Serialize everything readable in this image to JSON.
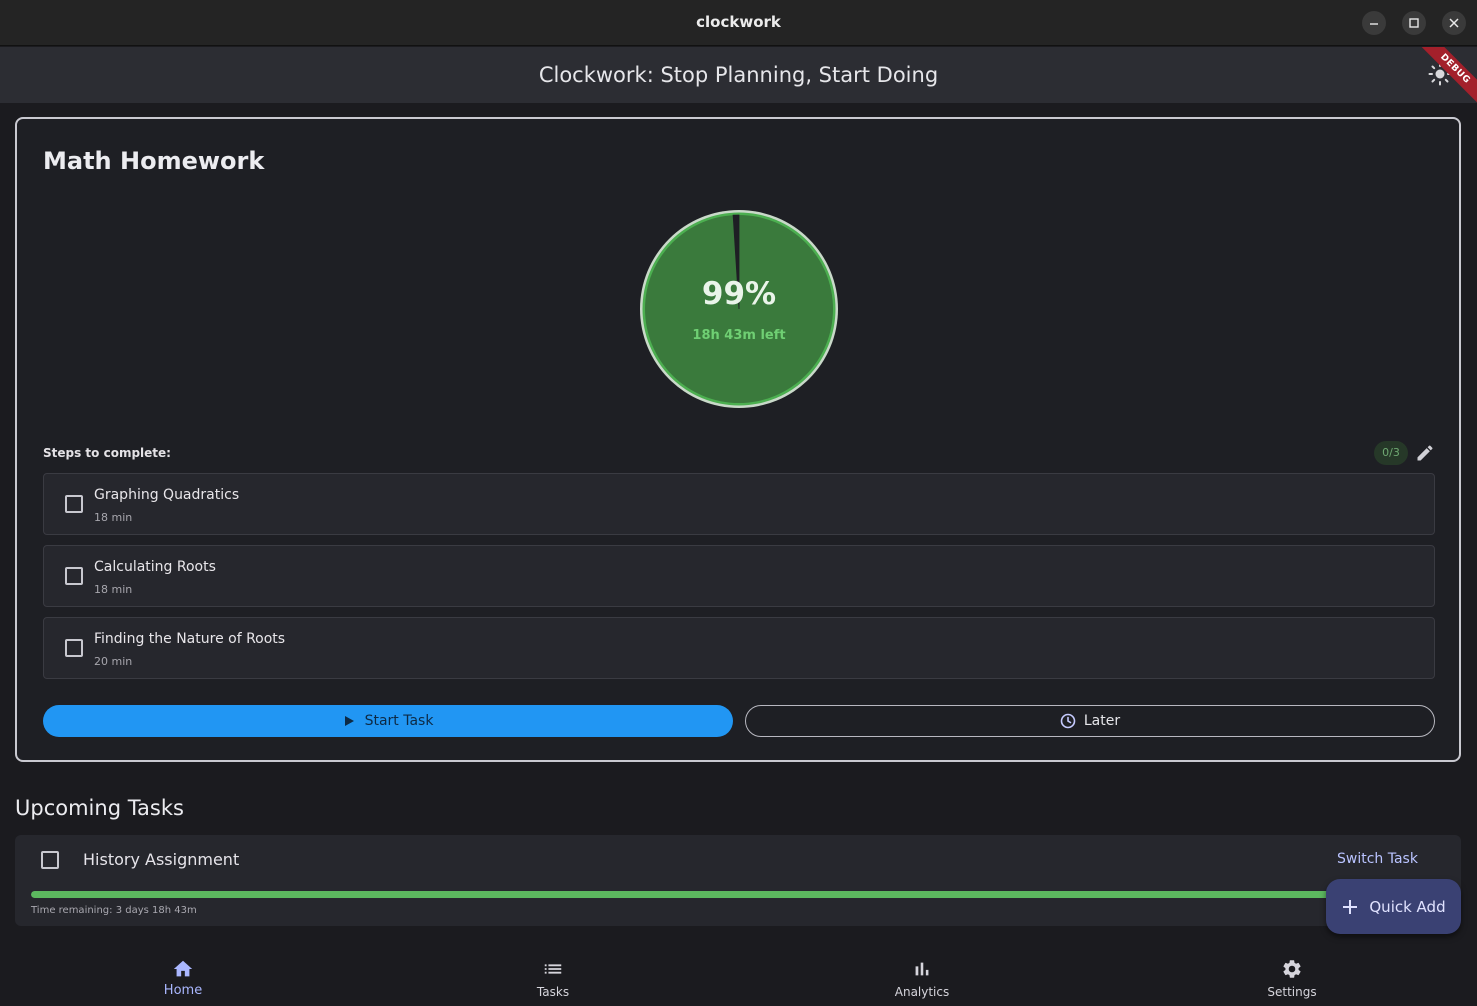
{
  "window": {
    "title": "clockwork",
    "controls": [
      "minimize",
      "maximize",
      "close"
    ]
  },
  "appbar": {
    "title": "Clockwork: Stop Planning, Start Doing",
    "theme_icon": "sun-icon",
    "debug_banner": "DEBUG"
  },
  "current_task": {
    "title": "Math Homework",
    "progress_percent": 99,
    "progress_label": "99%",
    "time_left": "18h 43m left",
    "steps_label": "Steps to complete:",
    "steps_count": "0/3",
    "steps": [
      {
        "name": "Graphing Quadratics",
        "duration": "18 min",
        "checked": false
      },
      {
        "name": "Calculating Roots",
        "duration": "18 min",
        "checked": false
      },
      {
        "name": "Finding the Nature of Roots",
        "duration": "20 min",
        "checked": false
      }
    ],
    "start_label": "Start Task",
    "later_label": "Later"
  },
  "upcoming": {
    "heading": "Upcoming Tasks",
    "tasks": [
      {
        "name": "History Assignment",
        "action": "Switch Task",
        "progress_fraction": 0.95,
        "remaining": "Time remaining: 3 days 18h 43m",
        "checked": false
      }
    ]
  },
  "fab": {
    "label": "Quick Add",
    "icon": "plus-icon"
  },
  "nav": {
    "items": [
      {
        "label": "Home",
        "icon": "home-icon",
        "active": true
      },
      {
        "label": "Tasks",
        "icon": "list-icon",
        "active": false
      },
      {
        "label": "Analytics",
        "icon": "bar-chart-icon",
        "active": false
      },
      {
        "label": "Settings",
        "icon": "gear-icon",
        "active": false
      }
    ]
  },
  "colors": {
    "accent_blue": "#2196f3",
    "progress_green": "#3a7a3c",
    "success_green": "#5cb85f",
    "fab_bg": "#3a4173",
    "nav_active": "#aab7ff"
  }
}
